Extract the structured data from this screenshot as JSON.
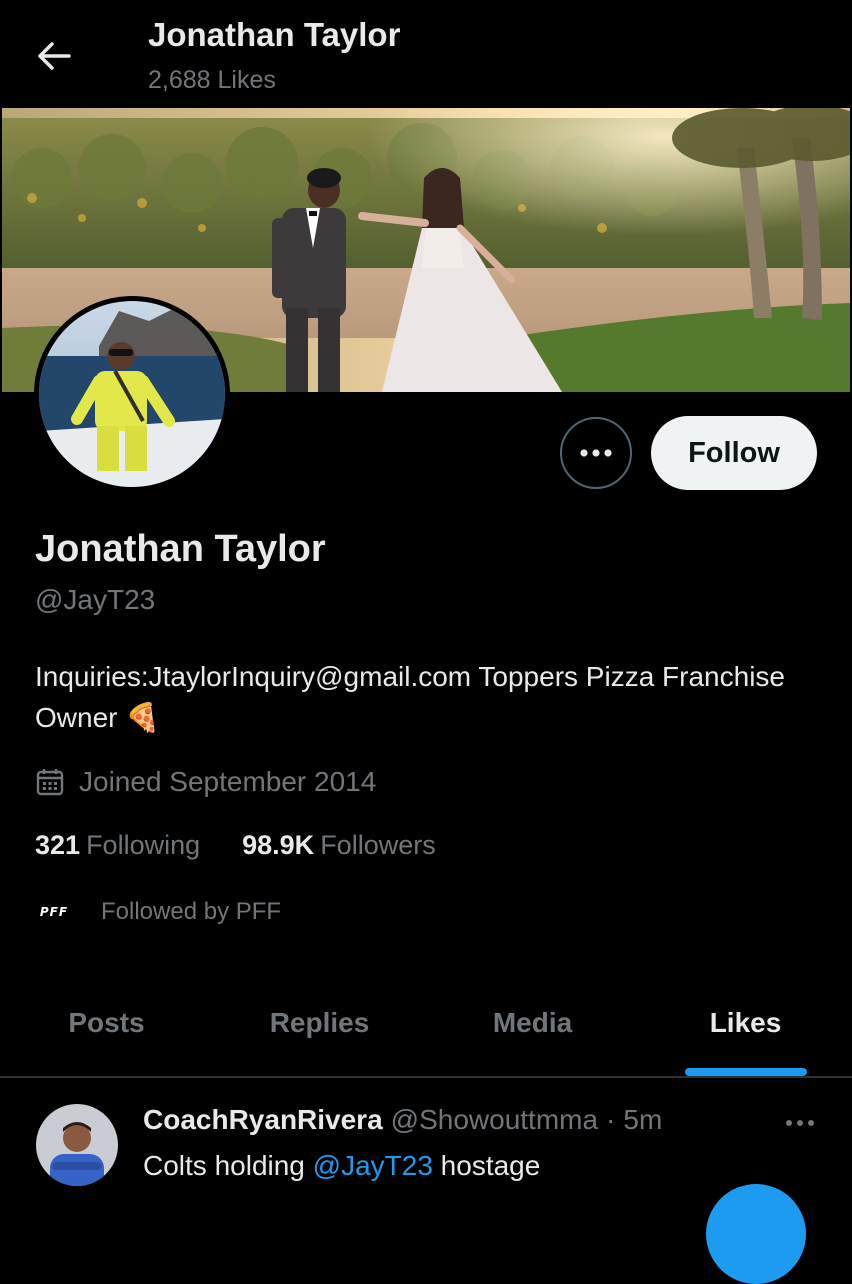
{
  "header": {
    "title": "Jonathan Taylor",
    "subtitle": "2,688 Likes"
  },
  "profile": {
    "display_name": "Jonathan Taylor",
    "handle": "@JayT23",
    "bio": "Inquiries:JtaylorInquiry@gmail.com Toppers Pizza Franchise Owner",
    "bio_emoji": "🍕",
    "joined": "Joined September 2014",
    "following_count": "321",
    "following_label": "Following",
    "followers_count": "98.9K",
    "followers_label": "Followers",
    "followed_by": "Followed by PFF",
    "followed_by_logo_text": "PFF"
  },
  "actions": {
    "follow_label": "Follow",
    "more_icon": "ellipsis-icon"
  },
  "tabs": [
    {
      "label": "Posts",
      "active": false
    },
    {
      "label": "Replies",
      "active": false
    },
    {
      "label": "Media",
      "active": false
    },
    {
      "label": "Likes",
      "active": true
    }
  ],
  "tweet": {
    "author_name": "CoachRyanRivera",
    "author_handle": "@Showouttmma",
    "separator": "·",
    "time": "5m",
    "text_before": "Colts holding ",
    "mention": "@JayT23",
    "text_after": " hostage"
  },
  "colors": {
    "background": "#000000",
    "text_primary": "#e7e9ea",
    "text_secondary": "#71767b",
    "accent": "#1d9bf0",
    "follow_button_bg": "#eff3f4",
    "divider": "#2f3336"
  }
}
